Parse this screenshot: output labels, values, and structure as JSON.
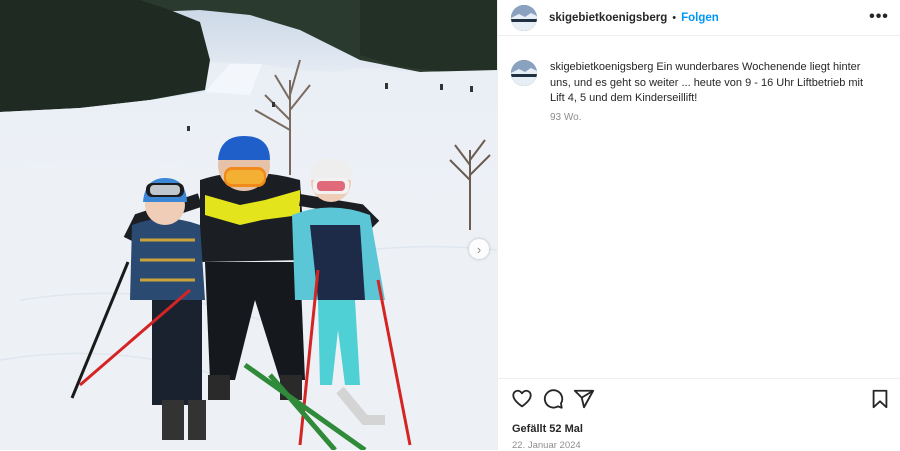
{
  "post": {
    "username": "skigebietkoenigsberg",
    "separator": "•",
    "follow_label": "Folgen",
    "more_icon": "more-horizontal-icon",
    "carousel_next": "›"
  },
  "caption": {
    "username": "skigebietkoenigsberg",
    "text": "Ein wunderbares Wochenende liegt hinter uns, und es geht so weiter ... heute von 9 - 16 Uhr Liftbetrieb mit Lift 4, 5 und dem Kinderseillift!",
    "time": "93 Wo."
  },
  "actions": {
    "like_icon": "heart-icon",
    "comment_icon": "comment-icon",
    "share_icon": "share-icon",
    "save_icon": "bookmark-icon"
  },
  "likes_text": "Gefällt 52 Mal",
  "date": "22. Januar 2024",
  "colors": {
    "follow_blue": "#0095f6",
    "text_primary": "#262626",
    "text_secondary": "#8e8e8e",
    "divider": "#efefef"
  }
}
